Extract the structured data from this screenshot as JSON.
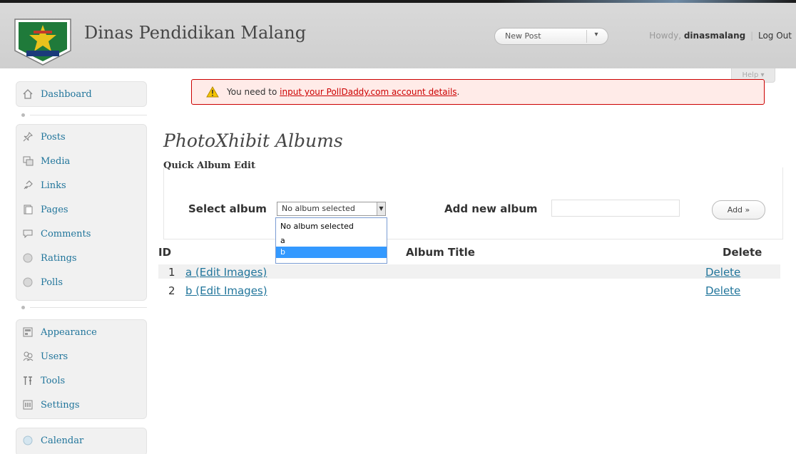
{
  "header": {
    "site_title": "Dinas Pendidikan Malang",
    "favorite_action": "New Post",
    "favorite_arrow": "▾",
    "greeting": "Howdy,",
    "username": "dinasmalang",
    "separator": "|",
    "logout": "Log Out"
  },
  "help_tab": "Help ▾",
  "sidebar": {
    "group1": [
      {
        "label": "Dashboard",
        "icon": "home-icon"
      }
    ],
    "group2": [
      {
        "label": "Posts",
        "icon": "pushpin-icon"
      },
      {
        "label": "Media",
        "icon": "media-icon"
      },
      {
        "label": "Links",
        "icon": "link-icon"
      },
      {
        "label": "Pages",
        "icon": "page-icon"
      },
      {
        "label": "Comments",
        "icon": "comment-icon"
      },
      {
        "label": "Ratings",
        "icon": "ratings-icon"
      },
      {
        "label": "Polls",
        "icon": "polls-icon"
      }
    ],
    "group3": [
      {
        "label": "Appearance",
        "icon": "appearance-icon"
      },
      {
        "label": "Users",
        "icon": "users-icon"
      },
      {
        "label": "Tools",
        "icon": "tools-icon"
      },
      {
        "label": "Settings",
        "icon": "settings-icon"
      }
    ],
    "group4": [
      {
        "label": "Calendar",
        "icon": "calendar-icon"
      }
    ]
  },
  "notice": {
    "prefix": "You need to ",
    "link": "input your PollDaddy.com account details",
    "suffix": "."
  },
  "main": {
    "page_title": "PhotoXhibit Albums",
    "subhead": "Quick Album Edit",
    "select_label": "Select album",
    "select_value": "No album selected",
    "select_options": [
      "No album selected",
      "a",
      "b"
    ],
    "add_label": "Add new album",
    "add_input_value": "",
    "add_button": "Add »"
  },
  "table": {
    "headers": {
      "id": "ID",
      "title": "Album Title",
      "delete": "Delete"
    },
    "rows": [
      {
        "id": "1",
        "title": "a (Edit Images)",
        "delete": "Delete"
      },
      {
        "id": "2",
        "title": "b (Edit Images)",
        "delete": "Delete"
      }
    ]
  },
  "colors": {
    "link": "#21759b",
    "notice_bg": "#ffebe8",
    "notice_border": "#cc0000",
    "dropdown_highlight": "#3399ff"
  }
}
